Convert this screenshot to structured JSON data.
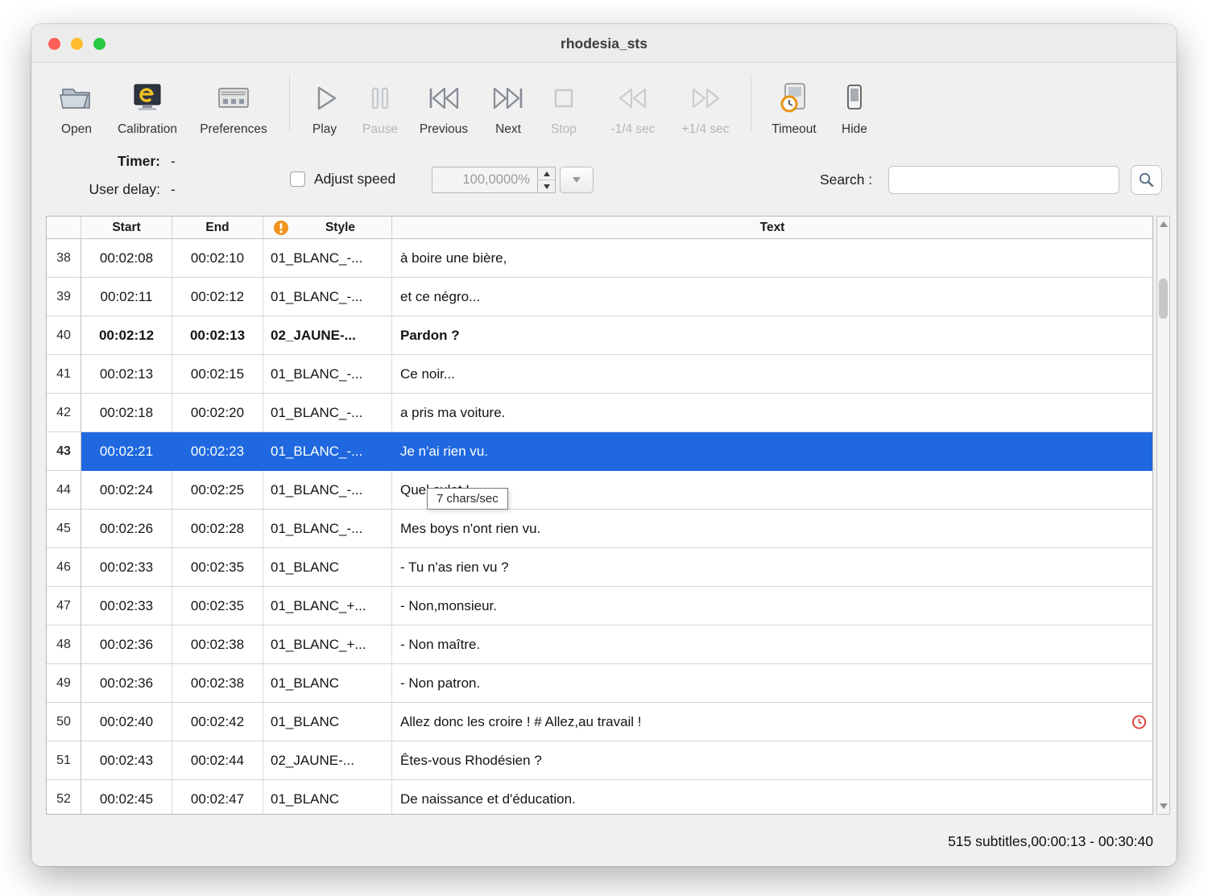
{
  "window": {
    "title": "rhodesia_sts"
  },
  "toolbar": {
    "open": "Open",
    "calibration": "Calibration",
    "preferences": "Preferences",
    "play": "Play",
    "pause": "Pause",
    "previous": "Previous",
    "next": "Next",
    "stop": "Stop",
    "minus_quarter": "-1/4 sec",
    "plus_quarter": "+1/4 sec",
    "timeout": "Timeout",
    "hide": "Hide"
  },
  "controls": {
    "timer_label": "Timer:",
    "timer_value": "-",
    "user_delay_label": "User delay:",
    "user_delay_value": "-",
    "adjust_speed_label": "Adjust speed",
    "speed_value": "100,0000%",
    "search_label": "Search :",
    "search_value": ""
  },
  "table": {
    "headers": {
      "num": "",
      "start": "Start",
      "end": "End",
      "style": "Style",
      "text": "Text"
    },
    "rows": [
      {
        "num": "38",
        "start": "00:02:08",
        "end": "00:02:10",
        "style": "01_BLANC_-...",
        "text": "à boire une bière,"
      },
      {
        "num": "39",
        "start": "00:02:11",
        "end": "00:02:12",
        "style": "01_BLANC_-...",
        "text": "et ce négro..."
      },
      {
        "num": "40",
        "start": "00:02:12",
        "end": "00:02:13",
        "style": "02_JAUNE-...",
        "text": "Pardon ?",
        "bold": true
      },
      {
        "num": "41",
        "start": "00:02:13",
        "end": "00:02:15",
        "style": "01_BLANC_-...",
        "text": "Ce noir..."
      },
      {
        "num": "42",
        "start": "00:02:18",
        "end": "00:02:20",
        "style": "01_BLANC_-...",
        "text": "a pris ma voiture."
      },
      {
        "num": "43",
        "start": "00:02:21",
        "end": "00:02:23",
        "style": "01_BLANC_-...",
        "text": "Je n'ai rien vu.",
        "selected": true
      },
      {
        "num": "44",
        "start": "00:02:24",
        "end": "00:02:25",
        "style": "01_BLANC_-...",
        "text": "Quel culot !"
      },
      {
        "num": "45",
        "start": "00:02:26",
        "end": "00:02:28",
        "style": "01_BLANC_-...",
        "text": "Mes boys n'ont rien vu."
      },
      {
        "num": "46",
        "start": "00:02:33",
        "end": "00:02:35",
        "style": "01_BLANC",
        "text": "- Tu n'as rien vu ?"
      },
      {
        "num": "47",
        "start": "00:02:33",
        "end": "00:02:35",
        "style": "01_BLANC_+...",
        "text": "- Non,monsieur."
      },
      {
        "num": "48",
        "start": "00:02:36",
        "end": "00:02:38",
        "style": "01_BLANC_+...",
        "text": "- Non maître."
      },
      {
        "num": "49",
        "start": "00:02:36",
        "end": "00:02:38",
        "style": "01_BLANC",
        "text": "- Non patron."
      },
      {
        "num": "50",
        "start": "00:02:40",
        "end": "00:02:42",
        "style": "01_BLANC",
        "text": "Allez donc les croire ! # Allez,au travail !",
        "clock": true
      },
      {
        "num": "51",
        "start": "00:02:43",
        "end": "00:02:44",
        "style": "02_JAUNE-...",
        "text": "Êtes-vous Rhodésien ?"
      },
      {
        "num": "52",
        "start": "00:02:45",
        "end": "00:02:47",
        "style": "01_BLANC",
        "text": "De naissance et d'éducation."
      }
    ]
  },
  "tooltip": {
    "text": "7 chars/sec"
  },
  "status": {
    "text": "515 subtitles,00:00:13 - 00:30:40"
  },
  "colors": {
    "selection_blue": "#1f68e0",
    "warning_orange": "#f0941f",
    "timeout_red": "#e23b32",
    "close_red": "#ff5f57",
    "minimize_yellow": "#febc2e",
    "zoom_green": "#28c840"
  }
}
